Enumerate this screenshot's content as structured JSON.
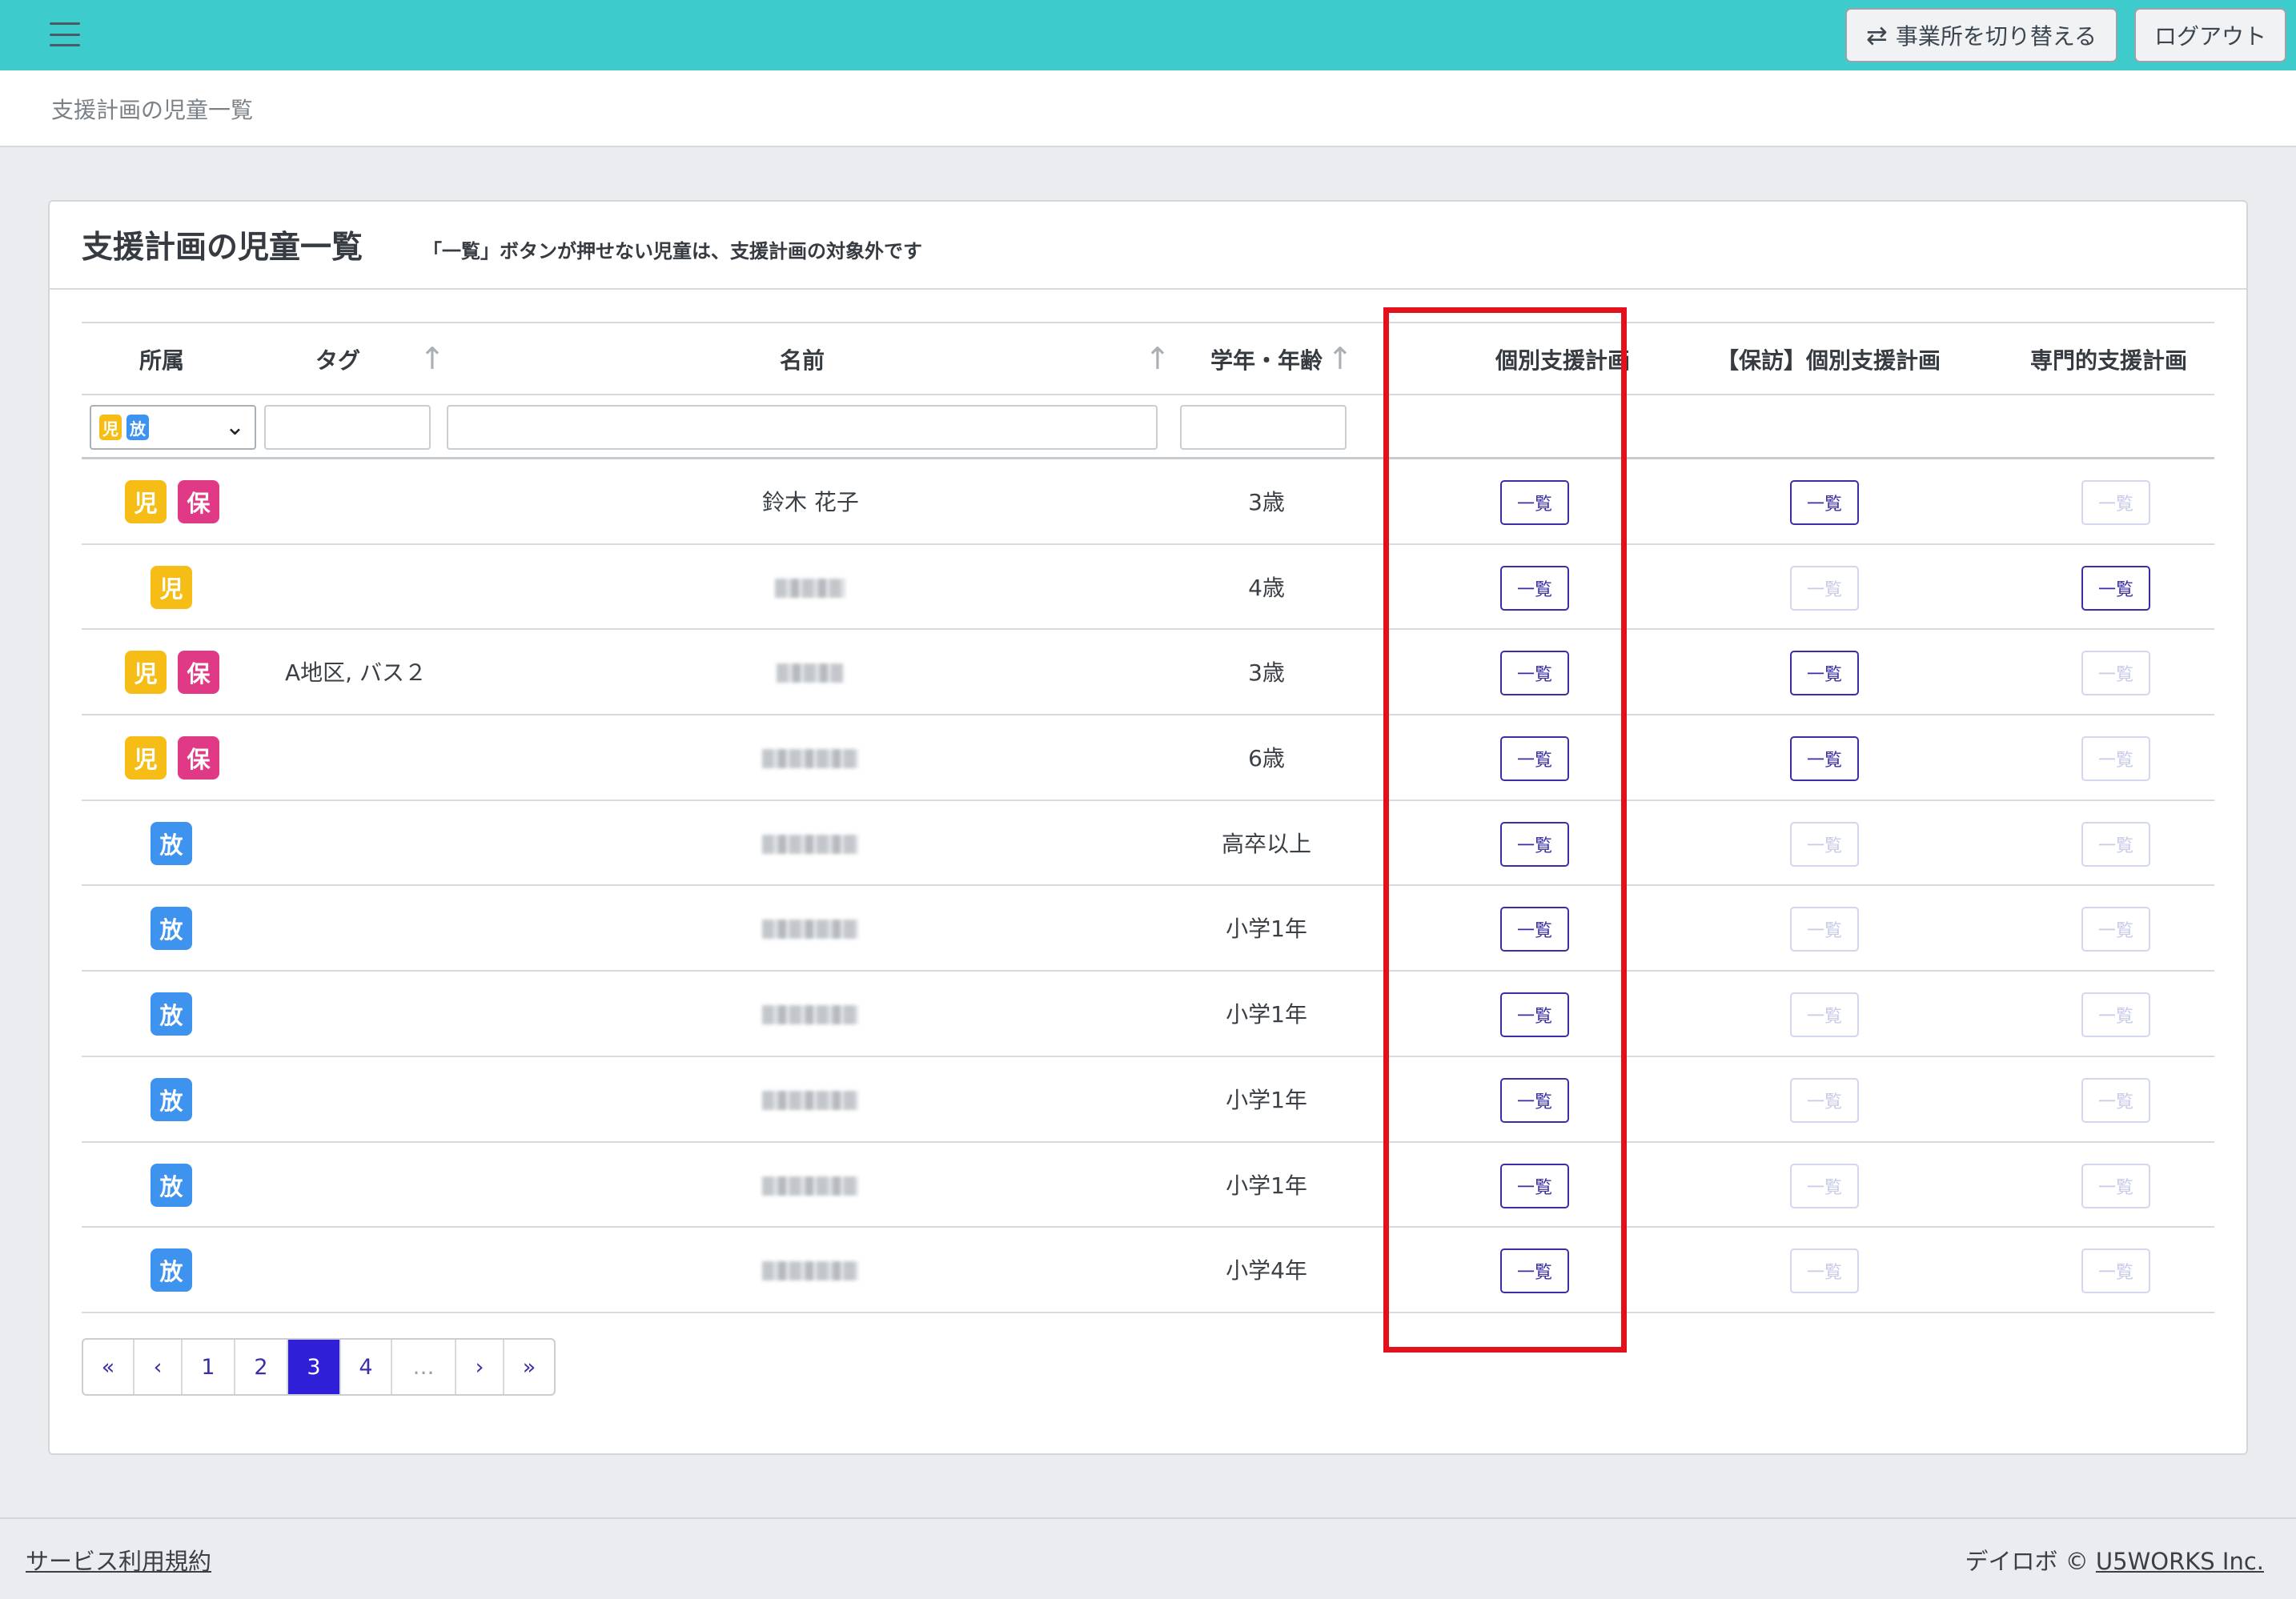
{
  "header": {
    "switch_label": "事業所を切り替える",
    "logout_label": "ログアウト",
    "menu_icon": "hamburger-icon",
    "switch_icon": "swap-arrows-icon"
  },
  "breadcrumb": "支援計画の児童一覧",
  "card": {
    "title": "支援計画の児童一覧",
    "note": "「一覧」ボタンが押せない児童は、支援計画の対象外です"
  },
  "table": {
    "columns": {
      "affiliation": "所属",
      "tag": "タグ",
      "name": "名前",
      "grade": "学年・年齢",
      "plan": "個別支援計画",
      "hoho_plan": "【保訪】個別支援計画",
      "special_plan": "専門的支援計画"
    },
    "filter": {
      "selected_badges": [
        "児",
        "放"
      ]
    },
    "button_label": "一覧",
    "rows": [
      {
        "badges": [
          "児",
          "保"
        ],
        "tag": "",
        "name": "鈴木 花子",
        "grade": "3歳",
        "plan": true,
        "hoho": true,
        "special": false
      },
      {
        "badges": [
          "児"
        ],
        "tag": "",
        "name": "",
        "grade": "4歳",
        "plan": true,
        "hoho": false,
        "special": true
      },
      {
        "badges": [
          "児",
          "保"
        ],
        "tag": "A地区, バス２",
        "name": "",
        "grade": "3歳",
        "plan": true,
        "hoho": true,
        "special": false
      },
      {
        "badges": [
          "児",
          "保"
        ],
        "tag": "",
        "name": "",
        "grade": "6歳",
        "plan": true,
        "hoho": true,
        "special": false
      },
      {
        "badges": [
          "放"
        ],
        "tag": "",
        "name": "",
        "grade": "高卒以上",
        "plan": true,
        "hoho": false,
        "special": false
      },
      {
        "badges": [
          "放"
        ],
        "tag": "",
        "name": "",
        "grade": "小学1年",
        "plan": true,
        "hoho": false,
        "special": false
      },
      {
        "badges": [
          "放"
        ],
        "tag": "",
        "name": "",
        "grade": "小学1年",
        "plan": true,
        "hoho": false,
        "special": false
      },
      {
        "badges": [
          "放"
        ],
        "tag": "",
        "name": "",
        "grade": "小学1年",
        "plan": true,
        "hoho": false,
        "special": false
      },
      {
        "badges": [
          "放"
        ],
        "tag": "",
        "name": "",
        "grade": "小学1年",
        "plan": true,
        "hoho": false,
        "special": false
      },
      {
        "badges": [
          "放"
        ],
        "tag": "",
        "name": "",
        "grade": "小学4年",
        "plan": true,
        "hoho": false,
        "special": false
      }
    ]
  },
  "pagination": {
    "items": [
      "«",
      "‹",
      "1",
      "2",
      "3",
      "4",
      "…",
      "›",
      "»"
    ],
    "current": "3"
  },
  "footer": {
    "terms": "サービス利用規約",
    "copyright_prefix": "デイロボ © ",
    "company": "U5WORKS Inc."
  },
  "colors": {
    "topbar": "#3dcbcb",
    "badge_ji": "#f6bd16",
    "badge_ho": "#e03a86",
    "badge_kou": "#3d93ee",
    "primary": "#3a2fa8",
    "highlight": "#e3111b"
  }
}
